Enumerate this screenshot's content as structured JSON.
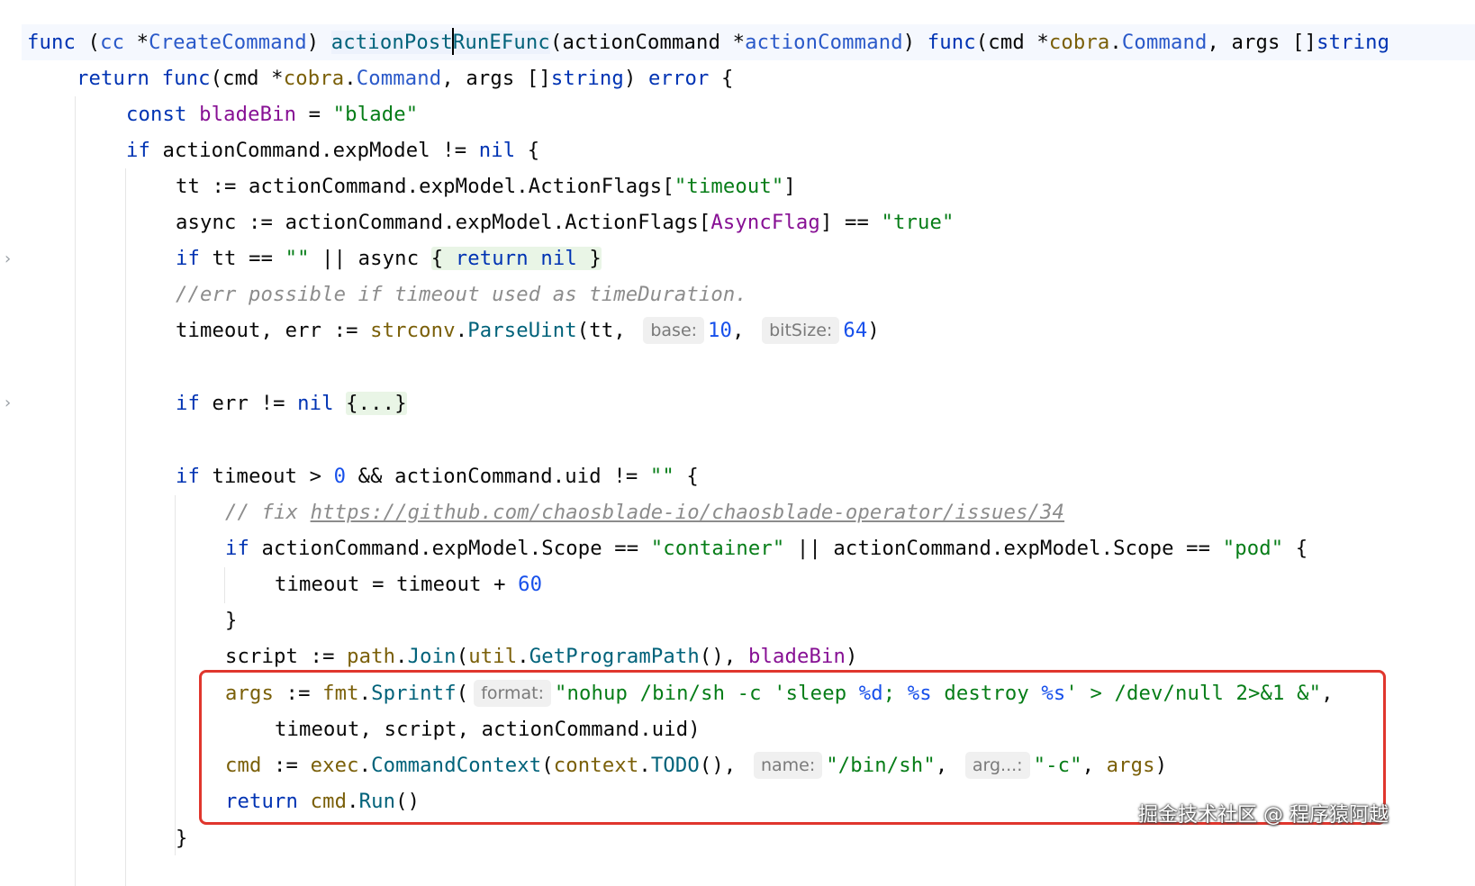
{
  "editor": {
    "language": "Go",
    "caret_line": 1,
    "lines": {
      "l1": {
        "kw_func": "func",
        "open": " (",
        "recv": "cc",
        "mid": " *",
        "recv_type": "CreateCommand",
        "close": ") ",
        "name_a": "actionPost",
        "name_b": "RunEFunc",
        "p_open": "(",
        "p_name": "actionCommand",
        "p_mid": " *",
        "p_type": "actionCommand",
        "p_close": ") ",
        "ret_func": "func",
        "r_open": "(cmd *",
        "r_pkg": "cobra",
        "r_dot": ".",
        "r_type": "Command",
        "r_mid": ", args []",
        "r_str": "string"
      },
      "l2": {
        "kw_return": "return",
        "sp": " ",
        "kw_func": "func",
        "open": "(cmd *",
        "pkg": "cobra",
        "dot": ".",
        "type": "Command",
        "mid": ", args []",
        "str": "string",
        "close": ") ",
        "err": "error",
        "brace": " {"
      },
      "l3": {
        "kw": "const",
        "sp": " ",
        "name": "bladeBin",
        "eq": " = ",
        "val": "\"blade\""
      },
      "l4": {
        "kw": "if",
        "expr": " actionCommand.expModel != ",
        "nil": "nil",
        "brace": " {"
      },
      "l5": {
        "lhs": "tt := actionCommand.expModel.ActionFlags[",
        "key": "\"timeout\"",
        "rb": "]"
      },
      "l6": {
        "lhs": "async := actionCommand.expModel.ActionFlags[",
        "flag": "AsyncFlag",
        "mid": "] == ",
        "val": "\"true\""
      },
      "l7": {
        "kw": "if",
        "mid": " tt == ",
        "empty": "\"\"",
        "or": " || async ",
        "fold_open": "{ ",
        "kw_ret": "return",
        "sp": " ",
        "nil": "nil",
        "fold_close": " }"
      },
      "l8": {
        "comment": "//err possible if timeout used as timeDuration."
      },
      "l9": {
        "lhs": "timeout, err := ",
        "pkg": "strconv",
        "dot": ".",
        "fn": "ParseUint",
        "args": "(tt, ",
        "hint1": "base:",
        "num1": "10",
        "comma": ", ",
        "hint2": "bitSize:",
        "num2": "64",
        "close": ")"
      },
      "l10": {
        "kw": "if",
        "mid": " err != ",
        "nil": "nil",
        "sp": " ",
        "fold": "{...}"
      },
      "l11": {
        "kw": "if",
        "mid": " timeout > ",
        "zero": "0",
        "mid2": " && actionCommand.uid != ",
        "empty": "\"\"",
        "brace": " {"
      },
      "l12": {
        "comment": "// fix ",
        "link": "https://github.com/chaosblade-io/chaosblade-operator/issues/34"
      },
      "l13": {
        "kw": "if",
        "a": " actionCommand.expModel.Scope == ",
        "s1": "\"container\"",
        "b": " || actionCommand.expModel.Scope == ",
        "s2": "\"pod\"",
        "brace": " {"
      },
      "l14": {
        "lhs": "timeout = timeout + ",
        "num": "60"
      },
      "l15": {
        "brace": "}"
      },
      "l16": {
        "lhs": "script := ",
        "pkg": "path",
        "dot": ".",
        "fn": "Join",
        "open": "(",
        "pkg2": "util",
        "dot2": ".",
        "fn2": "GetProgramPath",
        "mid": "(), ",
        "const": "bladeBin",
        "close": ")"
      },
      "l17": {
        "var": "args",
        "op": " := ",
        "pkg": "fmt",
        "dot": ".",
        "fn": "Sprintf",
        "open": "(",
        "hint": "format:",
        "str_a": "\"nohup /bin/sh -c 'sleep ",
        "fmt1": "%d",
        "str_b": "; ",
        "fmt2": "%s",
        "str_c": " destroy ",
        "fmt3": "%s",
        "str_d": "' > /dev/null 2>&1 &\"",
        "comma": ","
      },
      "l18": {
        "text": "timeout, script, actionCommand.uid)"
      },
      "l19": {
        "var": "cmd",
        "op": " := ",
        "pkg": "exec",
        "dot": ".",
        "fn": "CommandContext",
        "open": "(",
        "pkg2": "context",
        "dot2": ".",
        "fn2": "TODO",
        "mid": "(), ",
        "hint1": "name:",
        "s1": "\"/bin/sh\"",
        "comma": ", ",
        "hint2": "arg...:",
        "s2": "\"-c\"",
        "comma2": ", ",
        "var2": "args",
        "close": ")"
      },
      "l20": {
        "kw": "return",
        "sp": " ",
        "var": "cmd",
        "dot": ".",
        "fn": "Run",
        "close": "()"
      },
      "l21": {
        "brace": "}"
      }
    },
    "fold_marker": "›"
  },
  "overlay": {
    "highlight_color": "#e0362d",
    "watermark": "掘金技术社区 @ 程序猿阿越"
  },
  "colors": {
    "keyword": "#0033b3",
    "function": "#00627a",
    "type": "#2a59c9",
    "package": "#7a5f08",
    "string": "#067d17",
    "number": "#1750eb",
    "constant": "#871094",
    "comment": "#8c8c8c"
  }
}
